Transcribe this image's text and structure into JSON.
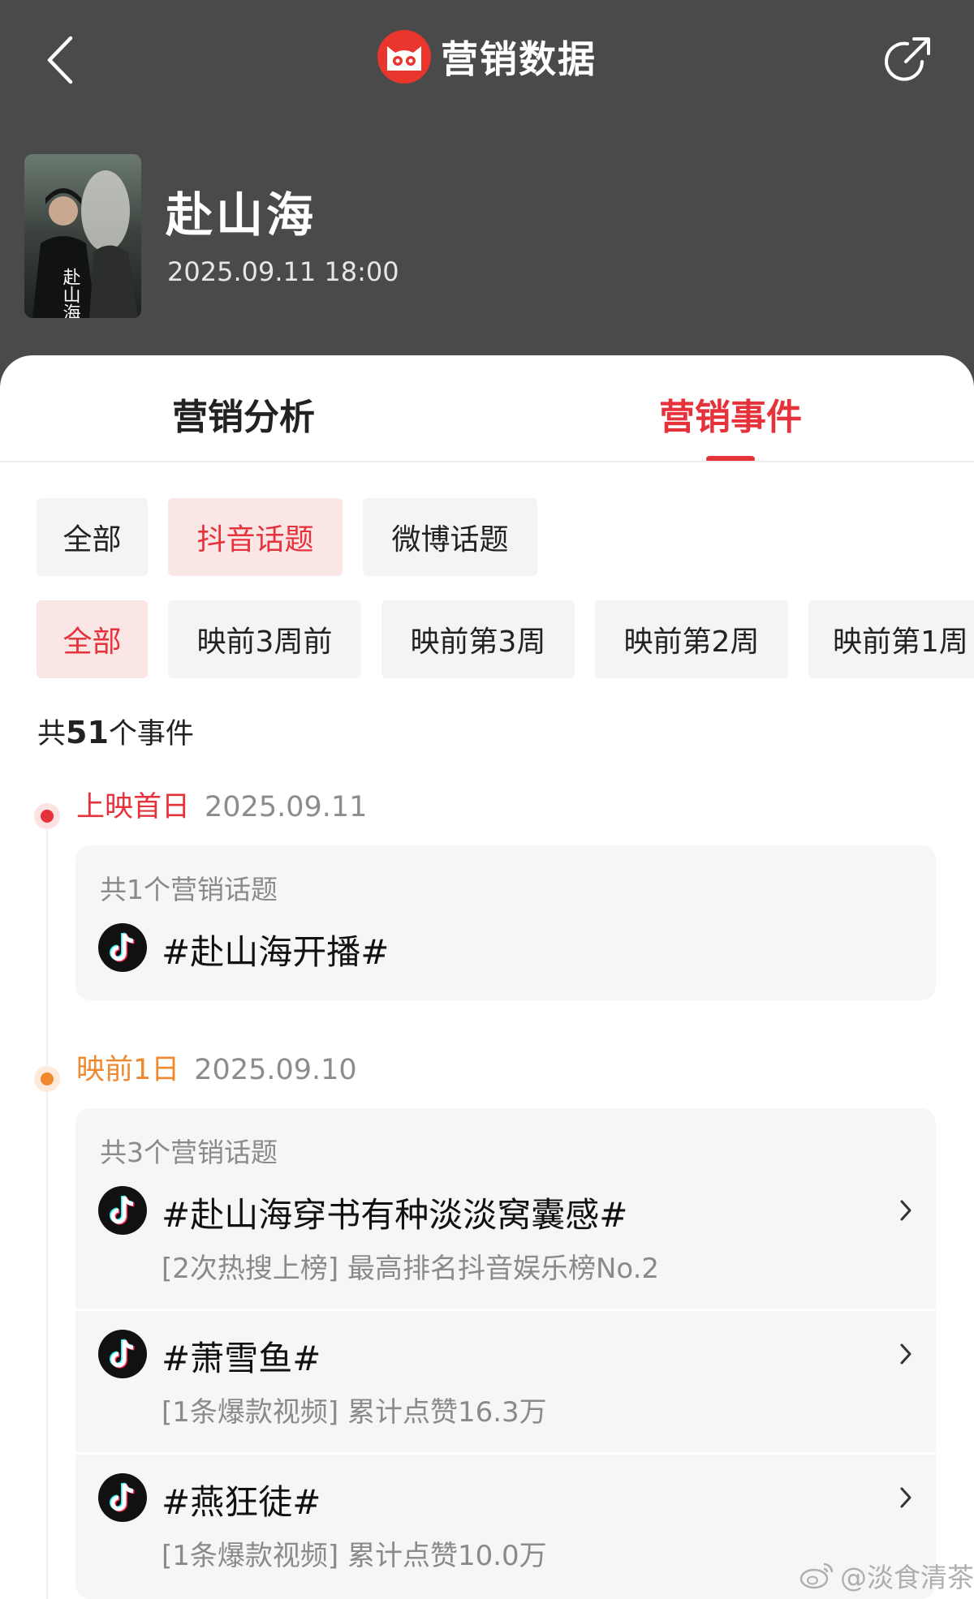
{
  "header": {
    "title": "营销数据",
    "back_icon": "chevron-left-icon",
    "share_icon": "share-icon",
    "logo_icon": "cat-logo-icon"
  },
  "movie": {
    "title": "赴山海",
    "release": "2025.09.11 18:00",
    "poster_text": "赴山海"
  },
  "tabs": [
    {
      "label": "营销分析",
      "active": false
    },
    {
      "label": "营销事件",
      "active": true
    }
  ],
  "platform_filters": [
    {
      "label": "全部",
      "active": false
    },
    {
      "label": "抖音话题",
      "active": true
    },
    {
      "label": "微博话题",
      "active": false
    }
  ],
  "period_filters": [
    {
      "label": "全部",
      "active": true
    },
    {
      "label": "映前3周前",
      "active": false
    },
    {
      "label": "映前第3周",
      "active": false
    },
    {
      "label": "映前第2周",
      "active": false
    },
    {
      "label": "映前第1周",
      "active": false
    }
  ],
  "summary": {
    "prefix": "共",
    "count": "51",
    "suffix": "个事件"
  },
  "events": [
    {
      "label": "上映首日",
      "date": "2025.09.11",
      "color": "#e5323b",
      "topic_count": "共1个营销话题",
      "topics": [
        {
          "name": "#赴山海开播#",
          "note": "",
          "icon": "douyin-icon"
        }
      ]
    },
    {
      "label": "映前1日",
      "date": "2025.09.10",
      "color": "#f0892e",
      "topic_count": "共3个营销话题",
      "topics": [
        {
          "name": "#赴山海穿书有种淡淡窝囊感#",
          "note": "[2次热搜上榜] 最高排名抖音娱乐榜No.2",
          "icon": "douyin-icon"
        },
        {
          "name": "#萧雪鱼#",
          "note": "[1条爆款视频] 累计点赞16.3万",
          "icon": "douyin-icon"
        },
        {
          "name": "#燕狂徒#",
          "note": "[1条爆款视频] 累计点赞10.0万",
          "icon": "douyin-icon"
        }
      ]
    }
  ],
  "watermark": {
    "text": "@淡食清茶",
    "icon": "weibo-icon"
  },
  "colors": {
    "accent": "#e5323b",
    "header_bg": "#4a4a4a",
    "orange": "#f0892e"
  }
}
